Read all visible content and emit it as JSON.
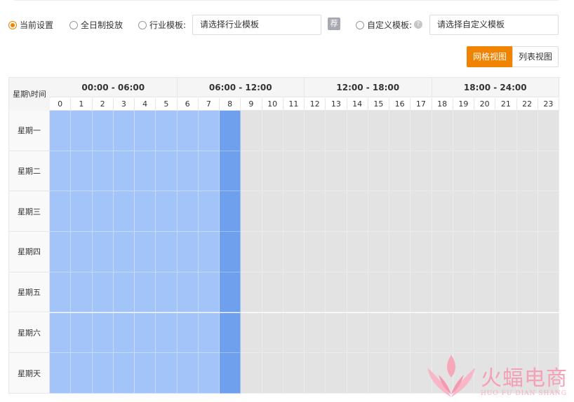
{
  "options": {
    "current": "当前设置",
    "all_day": "全日制投放",
    "industry": "行业模板:",
    "industry_placeholder": "请选择行业模板",
    "tui_badge": "荐",
    "custom": "自定义模板:",
    "custom_placeholder": "请选择自定义模板"
  },
  "view_toggle": {
    "grid": "网格视图",
    "list": "列表视图"
  },
  "grid": {
    "corner": "星期\\时间",
    "periods": [
      "00:00 - 06:00",
      "06:00 - 12:00",
      "12:00 - 18:00",
      "18:00 - 24:00"
    ],
    "hours": [
      "0",
      "1",
      "2",
      "3",
      "4",
      "5",
      "6",
      "7",
      "8",
      "9",
      "10",
      "11",
      "12",
      "13",
      "14",
      "15",
      "16",
      "17",
      "18",
      "19",
      "20",
      "21",
      "22",
      "23"
    ],
    "days": [
      "星期一",
      "星期二",
      "星期三",
      "星期四",
      "星期五",
      "星期六",
      "星期天"
    ],
    "selected_hours": [
      0,
      1,
      2,
      3,
      4,
      5,
      6,
      7,
      8
    ],
    "highlighted_hours": [
      8
    ]
  },
  "watermark": {
    "cn": "火蝠电商",
    "en": "HUO FU DIAN SHANG"
  },
  "colors": {
    "accent": "#f08300",
    "selected": "#a3c4f8",
    "highlight": "#6fa0ee",
    "unselected": "#e3e3e3"
  }
}
